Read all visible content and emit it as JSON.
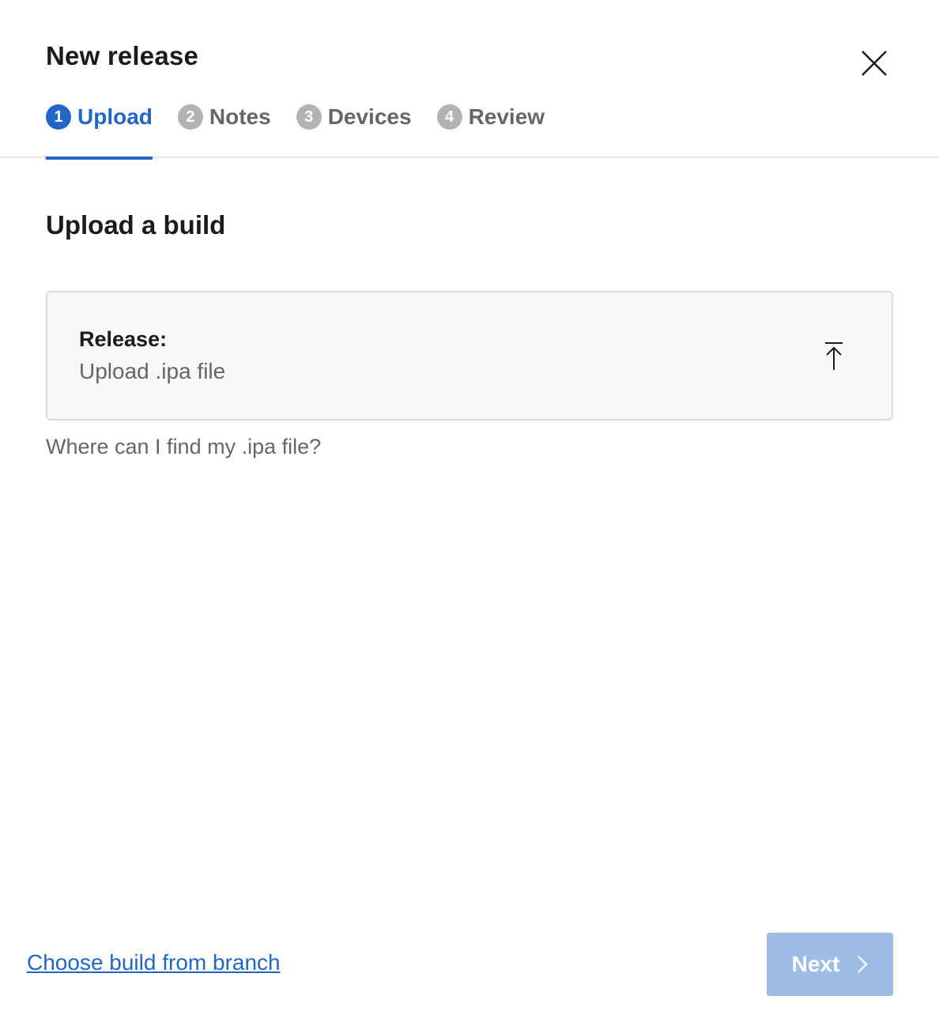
{
  "dialog": {
    "title": "New release",
    "close_label": "Close"
  },
  "steps": [
    {
      "number": "1",
      "label": "Upload",
      "active": true
    },
    {
      "number": "2",
      "label": "Notes",
      "active": false
    },
    {
      "number": "3",
      "label": "Devices",
      "active": false
    },
    {
      "number": "4",
      "label": "Review",
      "active": false
    }
  ],
  "content": {
    "section_title": "Upload a build",
    "upload_label": "Release:",
    "upload_value": "Upload .ipa file",
    "upload_icon": "upload-icon",
    "help_text": "Where can I find my .ipa file?"
  },
  "footer": {
    "branch_link": "Choose build from branch",
    "next_label": "Next",
    "next_icon": "chevron-right-icon"
  },
  "colors": {
    "accent": "#2266c7",
    "inactive_step": "#b3b3b3",
    "next_disabled": "#9dbde8"
  }
}
